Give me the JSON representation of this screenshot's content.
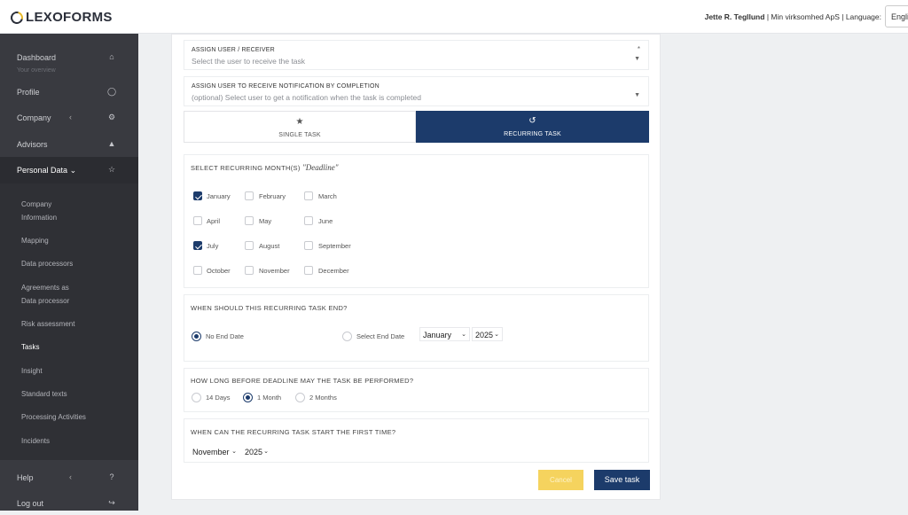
{
  "header": {
    "logo_text": "LEXOFORMS",
    "user_name": "Jette R. Tegllund",
    "company": "Min virksomhed ApS",
    "language_label": "Language:",
    "language_value": "English"
  },
  "sidebar": {
    "dashboard": "Dashboard",
    "dashboard_sub": "Your overview",
    "profile": "Profile",
    "company": "Company",
    "advisors": "Advisors",
    "personal_data": "Personal Data",
    "submenu": {
      "company_information_1": "Company",
      "company_information_2": "Information",
      "mapping": "Mapping",
      "data_processors": "Data processors",
      "agreements_1": "Agreements as",
      "agreements_2": "Data processor",
      "risk_assessment": "Risk assessment",
      "tasks": "Tasks",
      "insight": "Insight",
      "standard_texts": "Standard texts",
      "processing_activities": "Processing Activities",
      "incidents": "Incidents"
    },
    "help": "Help",
    "logout": "Log out"
  },
  "form": {
    "assign_user_title": "ASSIGN USER / RECEIVER",
    "assign_user_placeholder": "Select the user to receive the task",
    "notify_title": "ASSIGN USER TO RECEIVE NOTIFICATION BY COMPLETION",
    "notify_placeholder": "(optional) Select user to get a notification when the task is completed",
    "tab_single": "SINGLE TASK",
    "tab_recurring": "RECURRING TASK",
    "months_title": "SELECT RECURRING MONTH(S)",
    "months_title_em": "\"Deadline\"",
    "months": {
      "jan": "January",
      "feb": "February",
      "mar": "March",
      "apr": "April",
      "may": "May",
      "jun": "June",
      "jul": "July",
      "aug": "August",
      "sep": "September",
      "oct": "October",
      "nov": "November",
      "dec": "December"
    },
    "checked_months": [
      "January",
      "July"
    ],
    "end_title": "WHEN SHOULD THIS RECURRING TASK END?",
    "end_no_date": "No End Date",
    "end_select_date": "Select End Date",
    "end_month": "January",
    "end_year": "2025",
    "before_title": "HOW LONG BEFORE DEADLINE MAY THE TASK BE PERFORMED?",
    "before_14": "14 Days",
    "before_1m": "1 Month",
    "before_2m": "2 Months",
    "start_title": "WHEN CAN THE RECURRING TASK START THE FIRST TIME?",
    "start_month": "November",
    "start_year": "2025",
    "cancel_label": "Cancel",
    "save_label": "Save task"
  },
  "colors": {
    "primary": "#1c3b6b",
    "sidebar": "#393a40",
    "accent": "#f5d35e"
  }
}
